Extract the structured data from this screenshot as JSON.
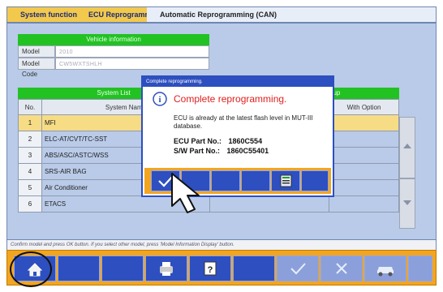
{
  "tabs": [
    {
      "label": "System function"
    },
    {
      "label": "ECU Reprogramming"
    },
    {
      "label": "Automatic Reprogramming (CAN)"
    }
  ],
  "vehicle_info": {
    "header": "Vehicle information",
    "model_year_label": "Model Year",
    "model_year_value": "2010",
    "model_code_label": "Model Code",
    "model_code_value": "CW5WXTSHLH"
  },
  "system_list": {
    "header": "System List",
    "right_header": "Option Setup",
    "columns": [
      "No.",
      "System Name",
      "",
      "With Option"
    ],
    "rows": [
      {
        "no": "1",
        "name": "MFI"
      },
      {
        "no": "2",
        "name": "ELC-AT/CVT/TC-SST"
      },
      {
        "no": "3",
        "name": "ABS/ASC/ASTC/WSS"
      },
      {
        "no": "4",
        "name": "SRS-AIR BAG"
      },
      {
        "no": "5",
        "name": "Air Conditioner"
      },
      {
        "no": "6",
        "name": "ETACS"
      }
    ],
    "selected_row": 1
  },
  "status_text": "Confirm model and press OK button. If you select other model, press 'Model Information Display' button.",
  "dialog": {
    "title": "Complete reprogramming.",
    "heading": "Complete reprogramming.",
    "message": "ECU is already at the latest flash level in MUT-III database.",
    "ecu_part_label": "ECU Part No.:",
    "ecu_part_value": "1860C554",
    "sw_part_label": "S/W Part No.:",
    "sw_part_value": "1860C55401"
  },
  "icons": {
    "info": "info-icon",
    "check": "check-icon",
    "home": "home-icon",
    "printer": "printer-icon",
    "help": "help-icon",
    "cancel": "cancel-icon",
    "vehicle": "car-icon",
    "pointer": "mouse-pointer-icon"
  },
  "colors": {
    "accent_blue": "#2d4fbf",
    "toolbar_orange": "#f3a51e",
    "header_green": "#22c222",
    "selected_row": "#f7dc86",
    "heading_red": "#e02020"
  }
}
